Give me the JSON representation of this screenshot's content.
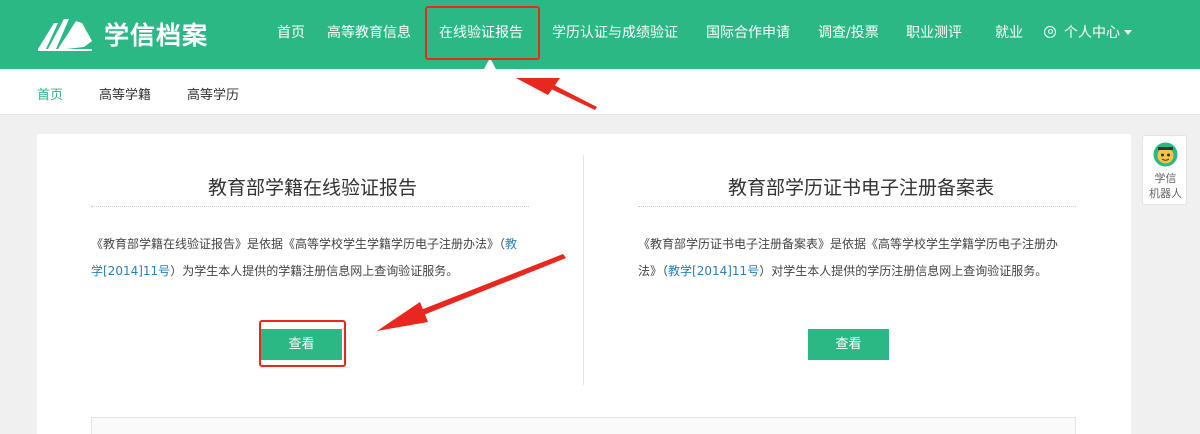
{
  "header": {
    "brand": "学信档案",
    "nav": [
      {
        "label": "首页"
      },
      {
        "label": "高等教育信息"
      },
      {
        "label": "在线验证报告"
      },
      {
        "label": "学历认证与成绩验证"
      },
      {
        "label": "国际合作申请"
      },
      {
        "label": "调查/投票"
      },
      {
        "label": "职业测评"
      },
      {
        "label": "就业"
      }
    ],
    "user_menu": "个人中心"
  },
  "subnav": [
    "首页",
    "高等学籍",
    "高等学历"
  ],
  "sections": [
    {
      "title": "教育部学籍在线验证报告",
      "desc_pre": "《教育部学籍在线验证报告》是依据《高等学校学生学籍学历电子注册办法》（",
      "desc_link": "教学[2014]11号",
      "desc_post": "）为学生本人提供的学籍注册信息网上查询验证服务。",
      "button": "查看"
    },
    {
      "title": "教育部学历证书电子注册备案表",
      "desc_pre": "《教育部学历证书电子注册备案表》是依据《高等学校学生学籍学历电子注册办法》（",
      "desc_link": "教学[2014]11号",
      "desc_post": "）对学生本人提供的学历注册信息网上查询验证服务。",
      "button": "查看"
    }
  ],
  "robot": {
    "line1": "学信",
    "line2": "机器人"
  },
  "colors": {
    "brand": "#2cb884",
    "annotation": "#e8281e",
    "link": "#2a7fb8"
  }
}
